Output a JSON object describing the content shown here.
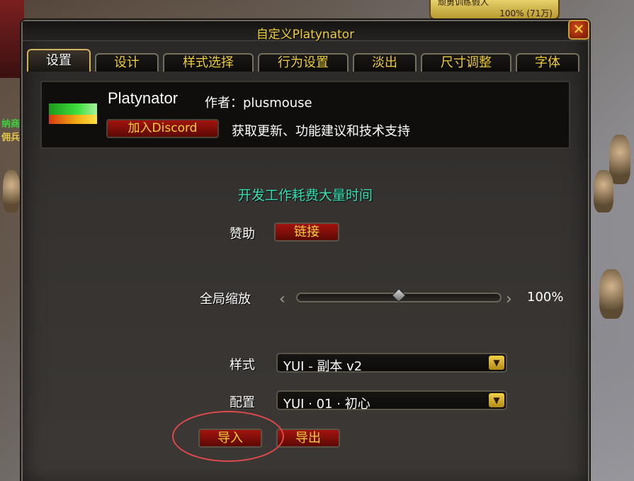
{
  "background": {
    "npc_text_green": "纳商",
    "npc_text_yellow": "佣兵"
  },
  "topbar": {
    "title": "顽勇训练假人",
    "value": "100% (71万)"
  },
  "window": {
    "title": "自定义Platynator",
    "close_label": "✕"
  },
  "tabs": [
    {
      "label": "设置",
      "active": true
    },
    {
      "label": "设计"
    },
    {
      "label": "样式选择"
    },
    {
      "label": "行为设置"
    },
    {
      "label": "淡出"
    },
    {
      "label": "尺寸调整"
    },
    {
      "label": "字体"
    }
  ],
  "header": {
    "addon_name": "Platynator",
    "author": "作者：plusmouse",
    "discord_button": "加入Discord",
    "discord_desc": "获取更新、功能建议和技术支持"
  },
  "main": {
    "dev_note": "开发工作耗费大量时间",
    "sponsor_label": "赞助",
    "sponsor_button": "链接",
    "scale_label": "全局缩放",
    "scale_value": "100%",
    "scale_fraction": 0.5,
    "style_label": "样式",
    "style_value": "YUI - 副本 v2",
    "config_label": "配置",
    "config_value": "YUI · 01 · 初心",
    "import_button": "导入",
    "export_button": "导出"
  },
  "colors": {
    "gold": "#f0cf3a",
    "teal": "#36e0b5",
    "button_red": "#a3130e",
    "highlight": "#e04a4a"
  }
}
